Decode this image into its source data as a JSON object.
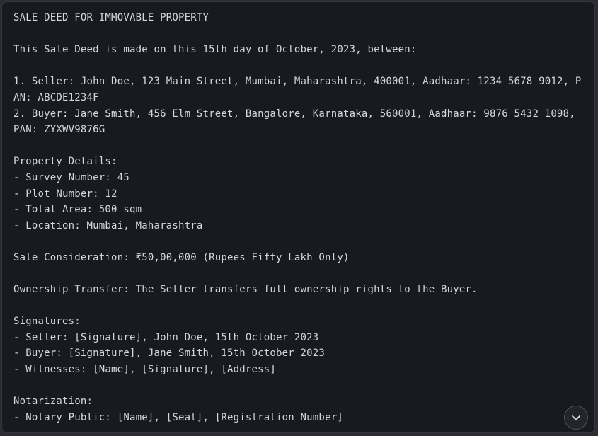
{
  "document": {
    "lines": [
      "SALE DEED FOR IMMOVABLE PROPERTY",
      "",
      "This Sale Deed is made on this 15th day of October, 2023, between:",
      "",
      "1. Seller: John Doe, 123 Main Street, Mumbai, Maharashtra, 400001, Aadhaar: 1234 5678 9012, PAN: ABCDE1234F",
      "2. Buyer: Jane Smith, 456 Elm Street, Bangalore, Karnataka, 560001, Aadhaar: 9876 5432 1098, PAN: ZYXWV9876G",
      "",
      "Property Details:",
      "- Survey Number: 45",
      "- Plot Number: 12",
      "- Total Area: 500 sqm",
      "- Location: Mumbai, Maharashtra",
      "",
      "Sale Consideration: ₹50,00,000 (Rupees Fifty Lakh Only)",
      "",
      "Ownership Transfer: The Seller transfers full ownership rights to the Buyer.",
      "",
      "Signatures:",
      "- Seller: [Signature], John Doe, 15th October 2023",
      "- Buyer: [Signature], Jane Smith, 15th October 2023",
      "- Witnesses: [Name], [Signature], [Address]",
      "",
      "Notarization:",
      "- Notary Public: [Name], [Seal], [Registration Number]"
    ]
  },
  "scroll_button": {
    "icon": "chevron-down-icon"
  },
  "colors": {
    "panel_background": "#181a20",
    "text": "#d6d7da",
    "button_border": "#53565e"
  }
}
